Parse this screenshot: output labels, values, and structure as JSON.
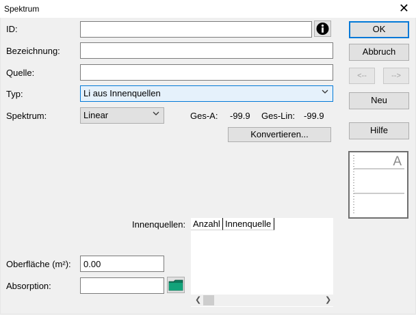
{
  "window": {
    "title": "Spektrum",
    "close_glyph": "✕"
  },
  "fields": {
    "id_label": "ID:",
    "id_value": "",
    "bezeichnung_label": "Bezeichnung:",
    "bezeichnung_value": "",
    "quelle_label": "Quelle:",
    "quelle_value": "",
    "typ_label": "Typ:",
    "typ_value": "Li aus Innenquellen",
    "spektrum_label": "Spektrum:",
    "spektrum_value": "Linear",
    "ges_a_label": "Ges-A:",
    "ges_a_value": "-99.9",
    "ges_lin_label": "Ges-Lin:",
    "ges_lin_value": "-99.9",
    "innenquellen_label": "Innenquellen:",
    "oberflaeche_label": "Oberfläche (m²):",
    "oberflaeche_value": "0.00",
    "absorption_label": "Absorption:",
    "absorption_value": ""
  },
  "buttons": {
    "ok": "OK",
    "abbruch": "Abbruch",
    "prev": "<--",
    "next": "-->",
    "neu": "Neu",
    "hilfe": "Hilfe",
    "konvertieren": "Konvertieren..."
  },
  "list": {
    "columns": [
      "Anzahl",
      "Innenquelle"
    ]
  },
  "preview": {
    "letter": "A"
  },
  "icons": {
    "info": "info-icon",
    "folder": "folder-icon",
    "chevron": "chevron-down-icon"
  }
}
